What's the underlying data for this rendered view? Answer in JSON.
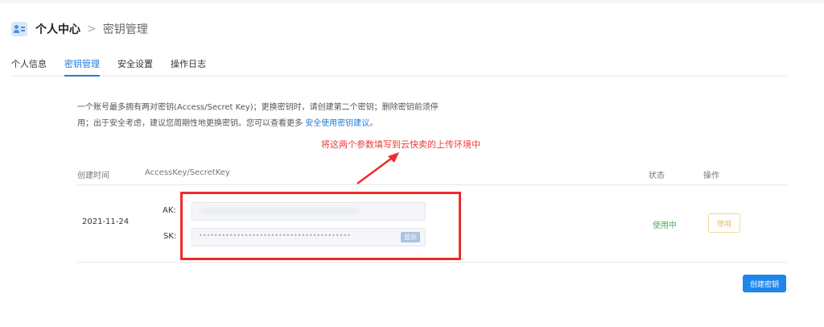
{
  "header": {
    "title": "个人中心",
    "separator": ">",
    "crumb": "密钥管理"
  },
  "tabs": [
    {
      "label": "个人信息"
    },
    {
      "label": "密钥管理"
    },
    {
      "label": "安全设置"
    },
    {
      "label": "操作日志"
    }
  ],
  "description": {
    "line1": "一个账号最多拥有两对密钥(Access/Secret Key)；更换密钥时，请创建第二个密钥；删除密钥前须停",
    "line2": "用；出于安全考虑，建议您周期性地更换密钥。您可以查看更多 ",
    "link": "安全使用密钥建议",
    "suffix": "。"
  },
  "annotation": {
    "note": "将这两个参数填写到云快卖的上传环境中",
    "color": "#f03a3a"
  },
  "table": {
    "headers": {
      "created": "创建时间",
      "keys": "AccessKey/SecretKey",
      "status": "状态",
      "action": "操作"
    },
    "row": {
      "date": "2021-11-24",
      "ak_label": "AK:",
      "sk_label": "SK:",
      "sk_mask": "••••••••••••••••••••••••••••••••••••••••",
      "show_label": "显示",
      "status": "使用中",
      "disable_label": "停用"
    }
  },
  "create_button": "创建密钥",
  "colors": {
    "accent": "#1f7ae0",
    "status_ok": "#4cae4c",
    "highlight": "#ef2b2b"
  }
}
